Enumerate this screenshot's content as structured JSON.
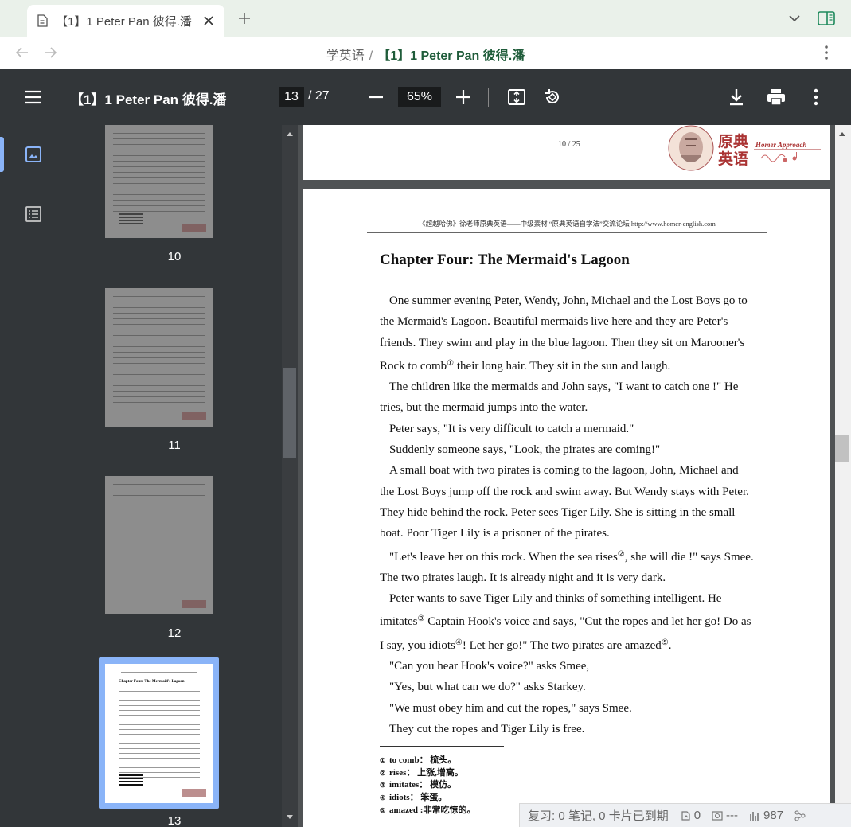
{
  "browser": {
    "tab_title": "【1】1 Peter Pan 彼得.潘",
    "breadcrumb_parent": "学英语",
    "breadcrumb_separator": "/",
    "breadcrumb_current": "【1】1 Peter Pan 彼得.潘"
  },
  "pdf_toolbar": {
    "title": "【1】1 Peter Pan 彼得.潘",
    "current_page": "13",
    "total_pages": "/ 27",
    "zoom": "65%"
  },
  "thumbnails": [
    {
      "label": "10"
    },
    {
      "label": "11"
    },
    {
      "label": "12"
    },
    {
      "label": "13",
      "selected": true
    }
  ],
  "thumbnail_13_heading": "Chapter Four: The Mermaid's Lagoon",
  "previous_page": {
    "page_number": "10 / 25",
    "logo_text_1": "原典",
    "logo_text_2": "英语",
    "logo_tagline": "Homer Approach"
  },
  "current_page": {
    "header": "《超越哈佛》徐老师原典英语——中级素材  “原典英语自学法”交流论坛 http://www.homer-english.com",
    "chapter_title": "Chapter Four: The Mermaid's Lagoon",
    "paragraphs": {
      "p1a": "One summer evening Peter, Wendy, John, Michael and the Lost Boys go to the Mermaid's Lagoon. Beautiful mermaids live here and they are Peter's friends. They swim and play in the blue lagoon. Then they sit on Marooner's Rock to comb",
      "p1_note": "①",
      "p1b": " their long hair. They sit in the sun and laugh.",
      "p2": "The children like the mermaids and John says, \"I want to catch one !\" He tries, but the mermaid jumps into the water.",
      "p3": "Peter says, \"It is very difficult to catch a mermaid.\"",
      "p4": "Suddenly someone says, \"Look, the pirates are coming!\"",
      "p5": "A small boat with two pirates is coming to the lagoon, John, Michael and the Lost Boys jump off the rock and swim away. But Wendy stays with Peter. They hide behind the rock. Peter sees Tiger Lily. She is sitting in the small boat. Poor Tiger Lily is a prisoner of the pirates.",
      "p6a": "\"Let's leave her on this rock. When the sea rises",
      "p6_note": "②",
      "p6b": ", she will die !\" says Smee. The two pirates laugh. It is already night and it is very dark.",
      "p7a": "Peter wants to save Tiger Lily and thinks of something intelligent. He imitates",
      "p7_note1": "③",
      "p7b": " Captain Hook's voice and says, \"Cut the ropes and let her go! Do as I say, you idiots",
      "p7_note2": "④",
      "p7c": "! Let her go!\" The two pirates are amazed",
      "p7_note3": "⑤",
      "p7d": ".",
      "p8": "\"Can you hear Hook's voice?\" asks Smee,",
      "p9": "\"Yes, but what can we do?\" asks Starkey.",
      "p10": "\"We must obey him and cut the ropes,\" says Smee.",
      "p11": "They cut the ropes and Tiger Lily is free."
    },
    "footnotes": [
      {
        "mark": "①",
        "text": "to comb： 梳头。"
      },
      {
        "mark": "②",
        "text": "rises： 上涨,增高。"
      },
      {
        "mark": "③",
        "text": "imitates： 模仿。"
      },
      {
        "mark": "④",
        "text": "idiots： 笨蛋。"
      },
      {
        "mark": "⑤",
        "text": "amazed :非常吃惊的。"
      }
    ]
  },
  "statusbar": {
    "review": "复习: 0 笔记, 0 卡片已到期",
    "count1": "0",
    "count2": "---",
    "count3": "987"
  },
  "colors": {
    "accent": "#8ab4f8",
    "toolbar": "#323639",
    "breadcrumb_current": "#1f5c3a"
  }
}
